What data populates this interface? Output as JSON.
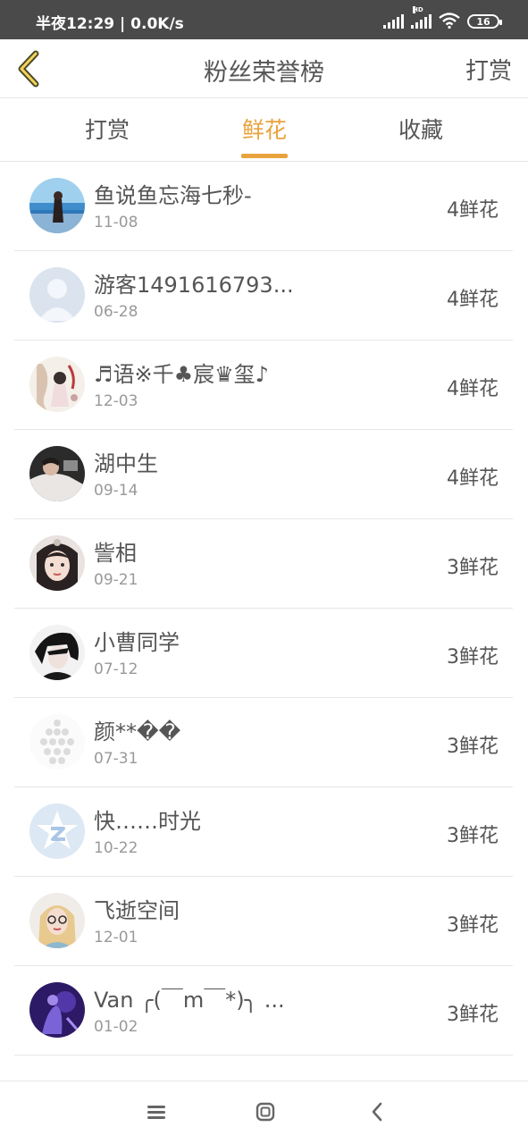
{
  "status_bar": {
    "time": "半夜12:29 | 0.0K/s",
    "battery": "16"
  },
  "header": {
    "title": "粉丝荣誉榜",
    "action": "打赏"
  },
  "tabs": [
    {
      "label": "打赏",
      "active": false
    },
    {
      "label": "鲜花",
      "active": true
    },
    {
      "label": "收藏",
      "active": false
    }
  ],
  "accent_color": "#e8a33d",
  "fans": [
    {
      "name": "鱼说鱼忘海七秒-",
      "date": "11-08",
      "amount": "4鲜花",
      "avatar": "beach-photo"
    },
    {
      "name": "游客1491616793...",
      "date": "06-28",
      "amount": "4鲜花",
      "avatar": "default-user"
    },
    {
      "name": "♬语※千♣宸♛玺♪",
      "date": "12-03",
      "amount": "4鲜花",
      "avatar": "illustration"
    },
    {
      "name": "湖中生",
      "date": "09-14",
      "amount": "4鲜花",
      "avatar": "person-photo"
    },
    {
      "name": "訾相",
      "date": "09-21",
      "amount": "3鲜花",
      "avatar": "costume-portrait"
    },
    {
      "name": "小曹同学",
      "date": "07-12",
      "amount": "3鲜花",
      "avatar": "anime-dark"
    },
    {
      "name": "颜**��",
      "date": "07-31",
      "amount": "3鲜花",
      "avatar": "light-pattern"
    },
    {
      "name": "快……时光",
      "date": "10-22",
      "amount": "3鲜花",
      "avatar": "qzone-star"
    },
    {
      "name": "飞逝空间",
      "date": "12-01",
      "amount": "3鲜花",
      "avatar": "blonde-portrait"
    },
    {
      "name": "Van ╭(￣m￣*)╮ ...",
      "date": "01-02",
      "amount": "3鲜花",
      "avatar": "purple-photo"
    }
  ]
}
